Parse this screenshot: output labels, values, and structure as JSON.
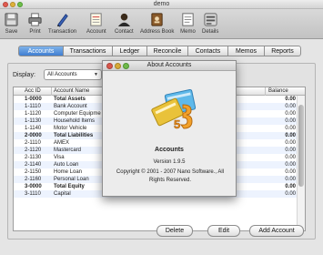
{
  "window": {
    "title": "demo"
  },
  "toolbar": {
    "items": [
      {
        "label": "Save",
        "icon": "save-icon"
      },
      {
        "label": "Print",
        "icon": "printer-icon"
      },
      {
        "label": "Transaction",
        "icon": "pen-icon"
      },
      {
        "label": "Account",
        "icon": "ledger-icon"
      },
      {
        "label": "Contact",
        "icon": "person-icon"
      },
      {
        "label": "Address Book",
        "icon": "address-book-icon"
      },
      {
        "label": "Memo",
        "icon": "memo-icon"
      },
      {
        "label": "Details",
        "icon": "details-icon"
      }
    ]
  },
  "tabs": [
    {
      "label": "Accounts",
      "active": true
    },
    {
      "label": "Transactions",
      "active": false
    },
    {
      "label": "Ledger",
      "active": false
    },
    {
      "label": "Reconcile",
      "active": false
    },
    {
      "label": "Contacts",
      "active": false
    },
    {
      "label": "Memos",
      "active": false
    },
    {
      "label": "Reports",
      "active": false
    }
  ],
  "filter": {
    "label": "Display:",
    "value": "All Accounts"
  },
  "table": {
    "headers": {
      "id": "Acc ID",
      "name": "Account Name",
      "balance": "Balance"
    },
    "rows": [
      {
        "id": "1-0000",
        "name": "Total Assets",
        "balance": "0.00",
        "bold": true
      },
      {
        "id": "1-1110",
        "name": "Bank Account",
        "balance": "0.00",
        "bold": false
      },
      {
        "id": "1-1120",
        "name": "Computer Equipme",
        "balance": "0.00",
        "bold": false
      },
      {
        "id": "1-1130",
        "name": "Household Items",
        "balance": "0.00",
        "bold": false
      },
      {
        "id": "1-1140",
        "name": "Motor Vehicle",
        "balance": "0.00",
        "bold": false
      },
      {
        "id": "2-0000",
        "name": "Total Liabilities",
        "balance": "0.00",
        "bold": true
      },
      {
        "id": "2-1110",
        "name": "AMEX",
        "balance": "0.00",
        "bold": false
      },
      {
        "id": "2-1120",
        "name": "Mastercard",
        "balance": "0.00",
        "bold": false
      },
      {
        "id": "2-1130",
        "name": "Visa",
        "balance": "0.00",
        "bold": false
      },
      {
        "id": "2-1140",
        "name": "Auto Loan",
        "balance": "0.00",
        "bold": false
      },
      {
        "id": "2-1150",
        "name": "Home Loan",
        "balance": "0.00",
        "bold": false
      },
      {
        "id": "2-1160",
        "name": "Personal Loan",
        "balance": "0.00",
        "bold": false
      },
      {
        "id": "3-0000",
        "name": "Total Equity",
        "balance": "0.00",
        "bold": true
      },
      {
        "id": "3-1110",
        "name": "Capital",
        "balance": "0.00",
        "bold": false
      }
    ]
  },
  "buttons": {
    "delete": "Delete",
    "edit": "Edit",
    "add": "Add Account"
  },
  "about": {
    "title": "About Accounts",
    "app_name": "Accounts",
    "version": "Version 1.9.5",
    "copyright": "Copyright © 2001 - 2007 Nano Software., All Rights Reserved."
  },
  "colors": {
    "active_tab": "#3f7ed1",
    "row_stripe": "#edf3fe"
  }
}
